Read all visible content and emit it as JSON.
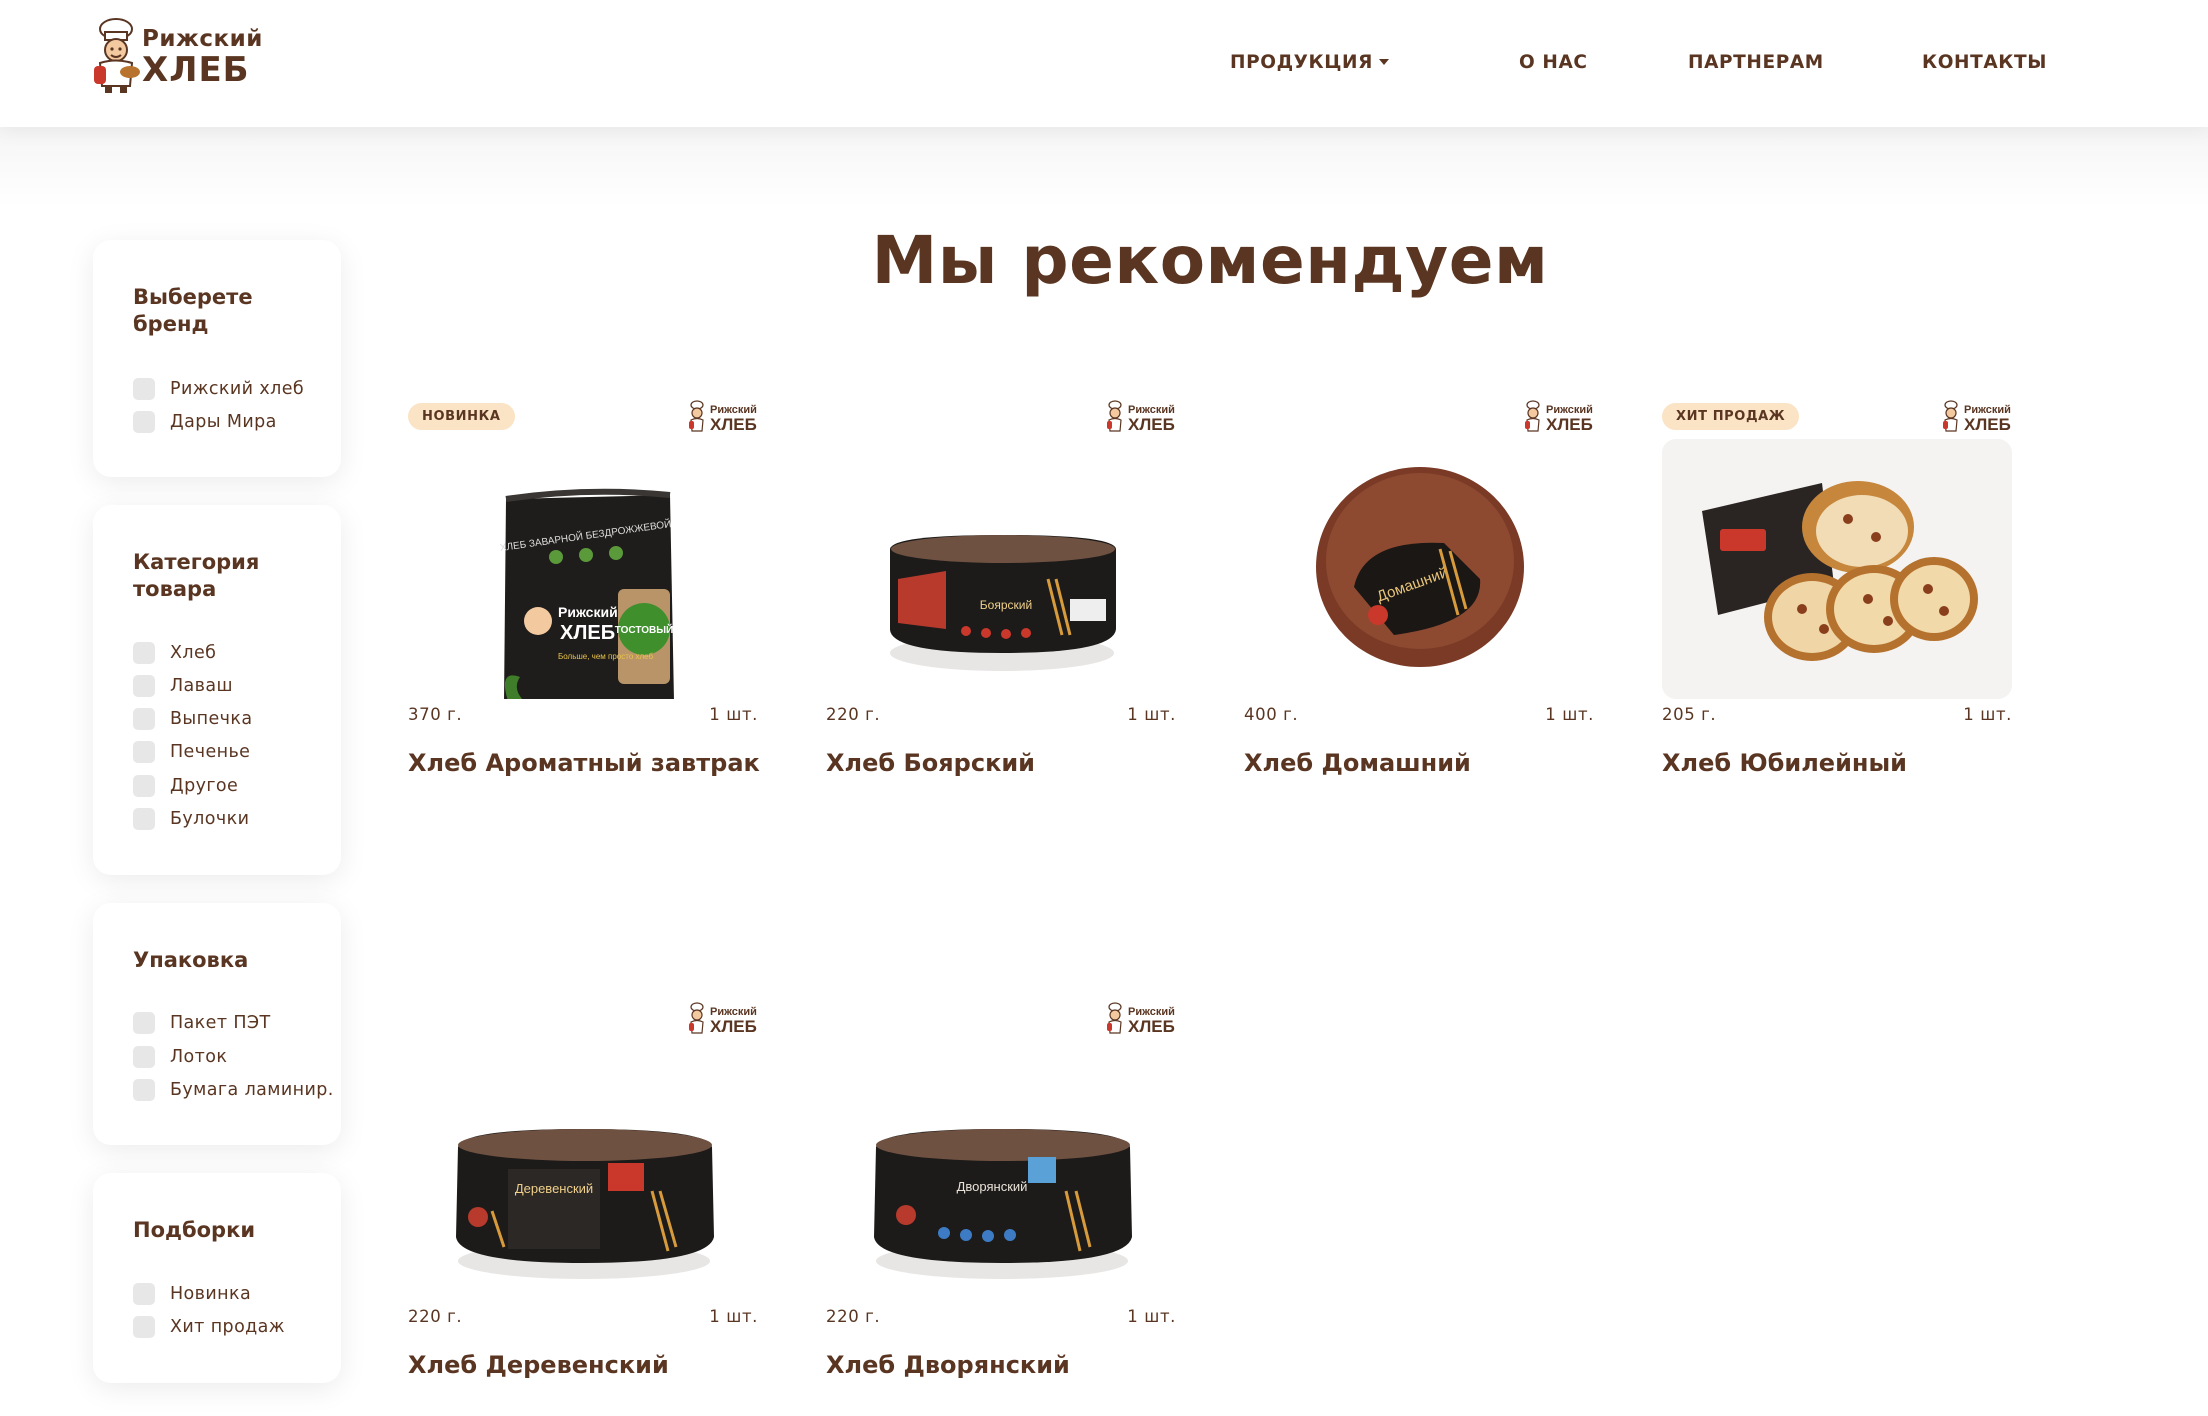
{
  "brand": {
    "line1": "Рижский",
    "line2": "ХЛЕБ"
  },
  "nav": [
    {
      "label": "ПРОДУКЦИЯ"
    },
    {
      "label": "О НАС"
    },
    {
      "label": "ПАРТНЕРАМ"
    },
    {
      "label": "КОНТАКТЫ"
    }
  ],
  "page_title": "Мы рекомендуем",
  "filters": [
    {
      "title": "Выберете бренд",
      "options": [
        "Рижский хлеб",
        "Дары Мира"
      ]
    },
    {
      "title": "Категория товара",
      "options": [
        "Хлеб",
        "Лаваш",
        "Выпечка",
        "Печенье",
        "Другое",
        "Булочки"
      ]
    },
    {
      "title": "Упаковка",
      "options": [
        "Пакет ПЭТ",
        "Лоток",
        "Бумага ламинир."
      ]
    },
    {
      "title": "Подборки",
      "options": [
        "Новинка",
        "Хит продаж"
      ]
    }
  ],
  "products": [
    {
      "name": "Хлеб Ароматный завтрак",
      "weight": "370 г.",
      "qty": "1 шт.",
      "badge": "НОВИНКА",
      "pack_text": "ТОСТОВЫЙ"
    },
    {
      "name": "Хлеб Боярский",
      "weight": "220 г.",
      "qty": "1 шт.",
      "badge": "",
      "pack_text": "Боярский"
    },
    {
      "name": "Хлеб Домашний",
      "weight": "400 г.",
      "qty": "1 шт.",
      "badge": "",
      "pack_text": "Домашний"
    },
    {
      "name": "Хлеб Юбилейный",
      "weight": "205 г.",
      "qty": "1 шт.",
      "badge": "ХИТ ПРОДАЖ",
      "pack_text": ""
    },
    {
      "name": "Хлеб Деревенский",
      "weight": "220 г.",
      "qty": "1 шт.",
      "badge": "",
      "pack_text": "Деревенский"
    },
    {
      "name": "Хлеб Дворянский",
      "weight": "220 г.",
      "qty": "1 шт.",
      "badge": "",
      "pack_text": "Дворянский"
    }
  ],
  "colors": {
    "brand_brown": "#5a3622",
    "badge_bg": "#fbe3c5",
    "checkbox": "#e7e7e7"
  }
}
